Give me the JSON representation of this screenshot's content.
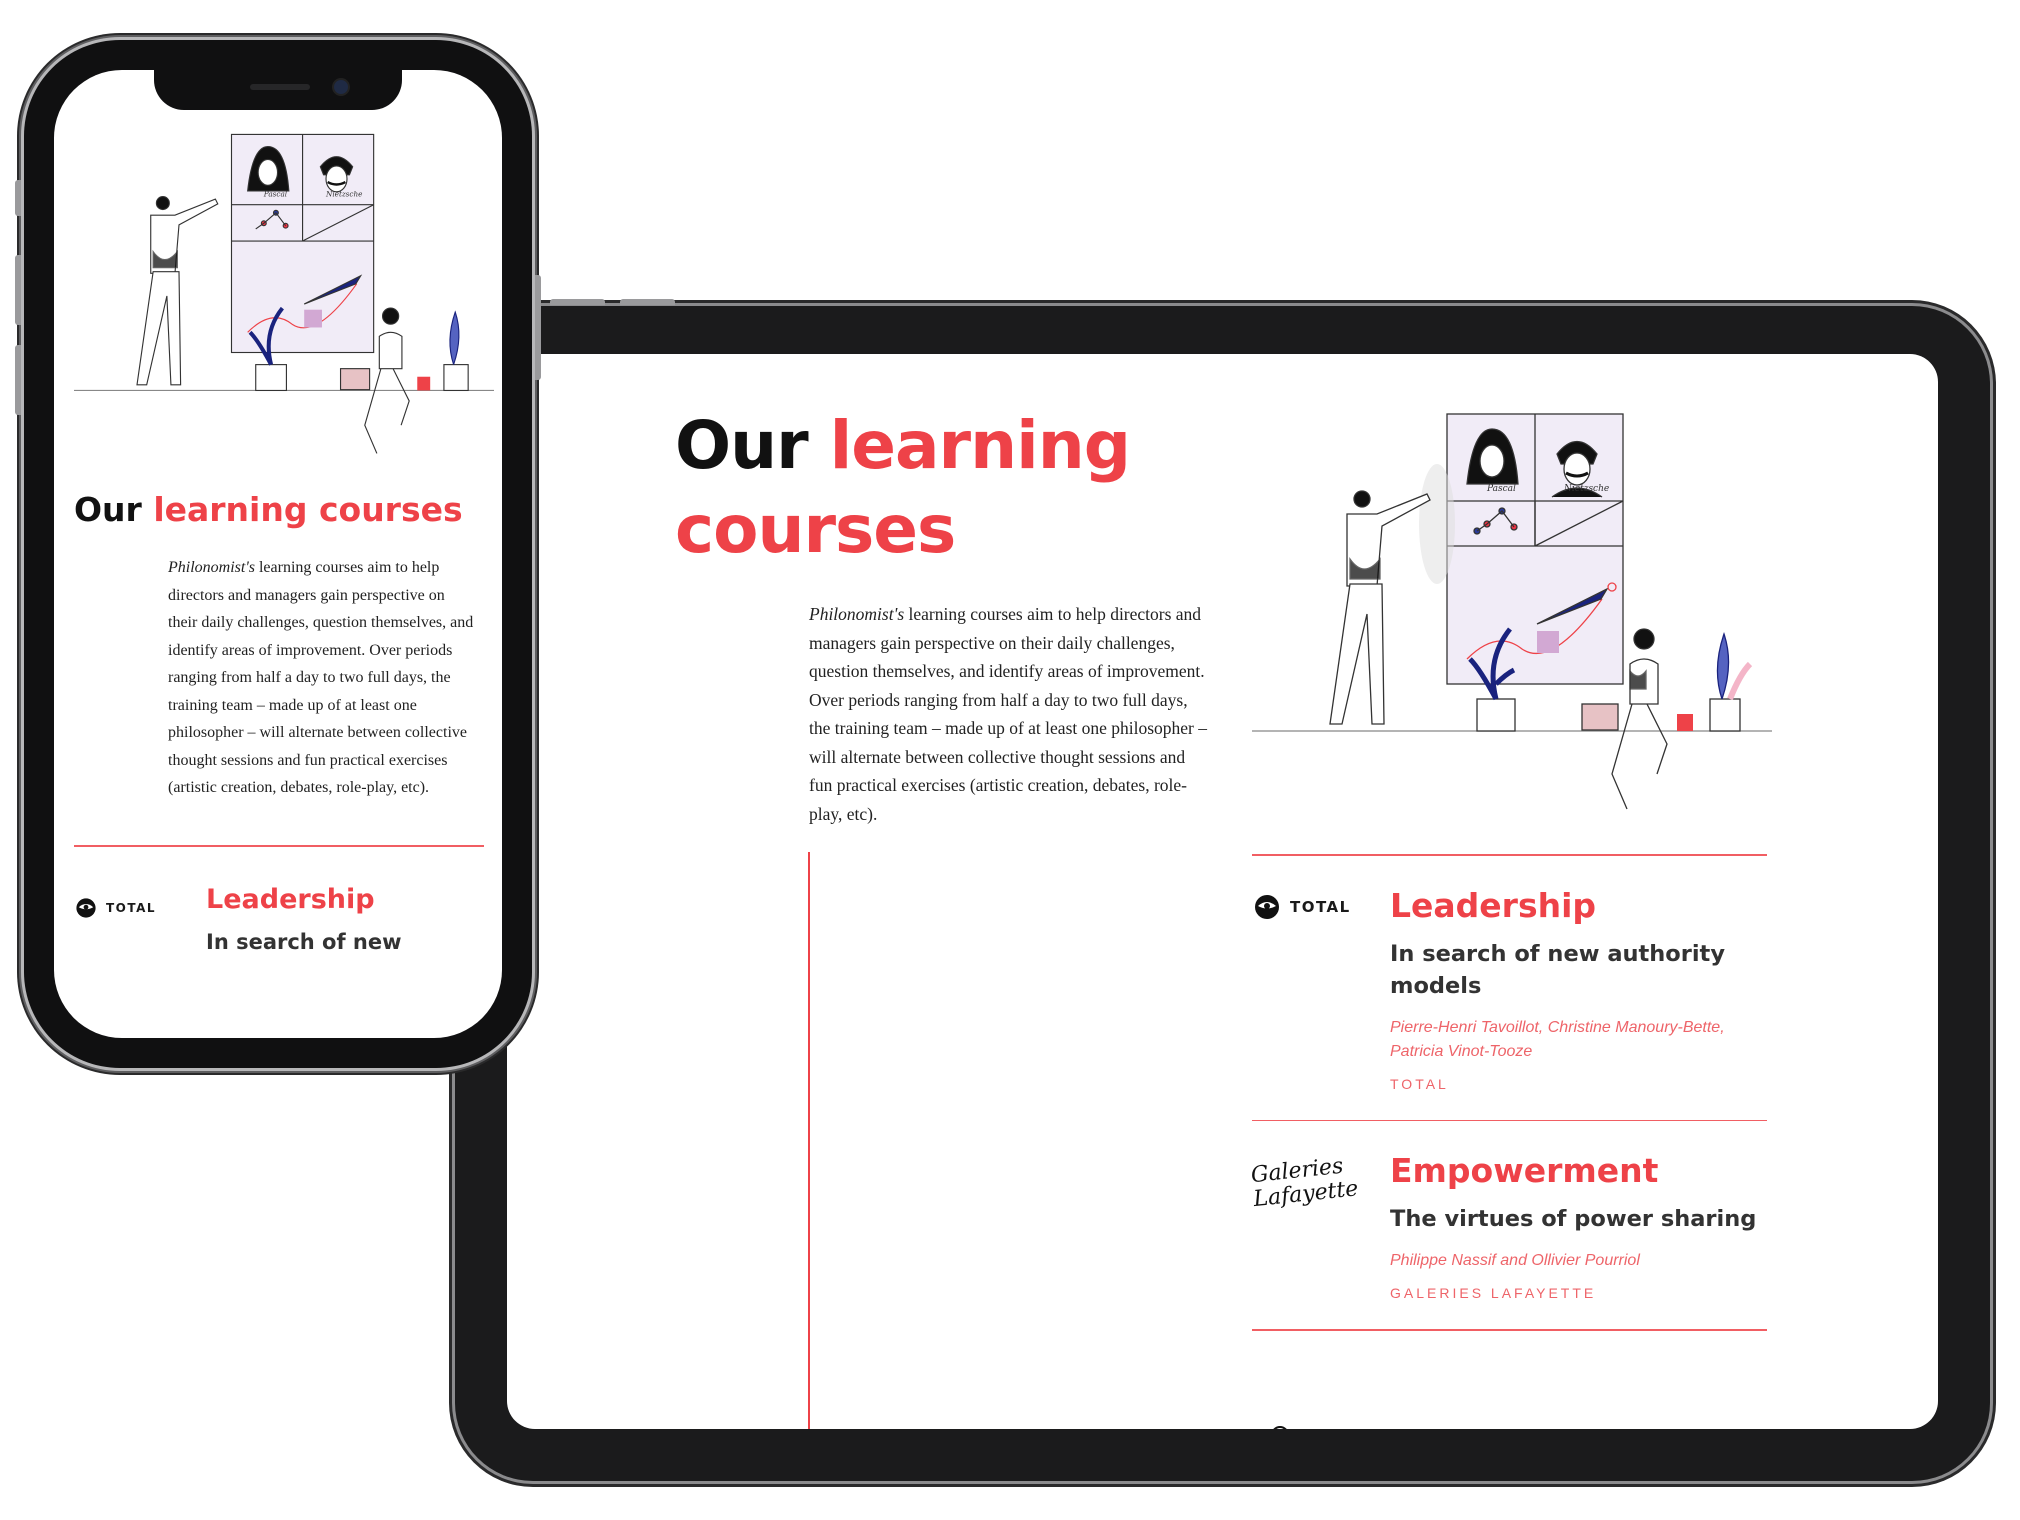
{
  "page": {
    "title_prefix": "Our ",
    "title_accent": "learning courses",
    "intro_em": "Philonomist's",
    "intro_rest": " learning courses aim to help directors and managers gain perspective on their daily challenges, question themselves, and identify areas of improvement. Over periods ranging from half a day to two full days, the training team – made up of at least one philosopher – will alternate between collective thought sessions and fun practical exercises (artistic creation, debates, role-play, etc).",
    "illustration": {
      "portrait_left": "Pascal",
      "portrait_right": "Nietzsche"
    }
  },
  "courses": [
    {
      "logo_icon": "total-logo-icon",
      "logo_text": "TOTAL",
      "title": "Leadership",
      "subtitle": "In search of new authority models",
      "authors": "Pierre-Henri Tavoillot, Christine Manoury-Bette, Patricia Vinot-Tooze",
      "company": "TOTAL"
    },
    {
      "logo_icon": "galeries-lafayette-logo-icon",
      "logo_text": "Galeries Lafayette",
      "title": "Empowerment",
      "subtitle": "The virtues of power sharing",
      "authors": "Philippe Nassif and Ollivier Pourriol",
      "company": "GALERIES LAFAYETTE"
    }
  ],
  "phone": {
    "subtitle_visible": "In search of new"
  },
  "colors": {
    "accent": "#ee4248",
    "device_frame": "#1b1b1c",
    "text": "#222222"
  }
}
